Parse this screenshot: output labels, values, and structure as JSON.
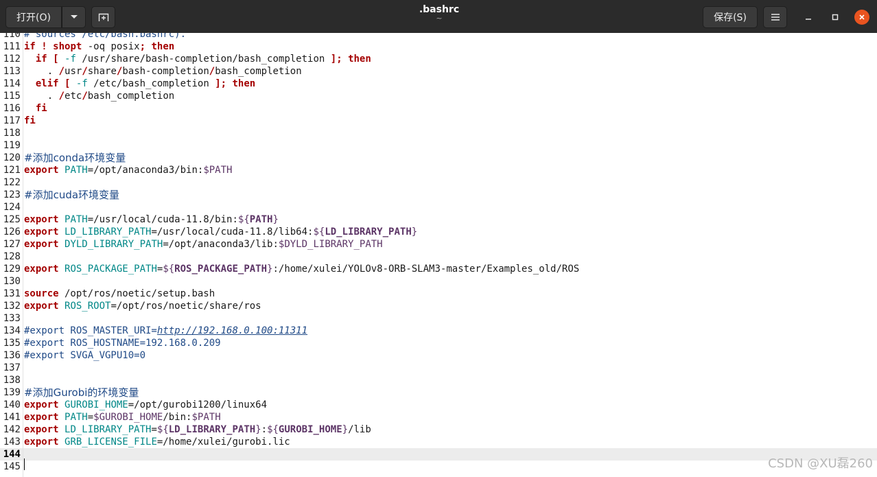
{
  "header": {
    "open_label": "打开(O)",
    "save_label": "保存(S)",
    "title": ".bashrc",
    "subtitle": "~"
  },
  "icons": {
    "open_dropdown": "chevron-down-icon",
    "new_tab": "new-tab-icon",
    "menu": "hamburger-icon",
    "minimize": "minimize-icon",
    "maximize": "maximize-icon",
    "close": "close-icon"
  },
  "colors": {
    "header_bg": "#2b2b2b",
    "close_accent": "#e95420",
    "keyword": "#a40000",
    "variable": "#008787",
    "comment": "#204a87"
  },
  "editor": {
    "current_line": "144",
    "lines": [
      {
        "n": "110",
        "parts": [
          {
            "t": "# sources /etc/bash.bashrc).",
            "c": "c"
          }
        ]
      },
      {
        "n": "111",
        "parts": [
          {
            "t": "if",
            "c": "k"
          },
          {
            "t": " ",
            "c": "t"
          },
          {
            "t": "!",
            "c": "k"
          },
          {
            "t": " ",
            "c": "t"
          },
          {
            "t": "shopt",
            "c": "k"
          },
          {
            "t": " -oq posix",
            "c": "t"
          },
          {
            "t": ";",
            "c": "k"
          },
          {
            "t": " ",
            "c": "t"
          },
          {
            "t": "then",
            "c": "k"
          }
        ]
      },
      {
        "n": "112",
        "parts": [
          {
            "t": "  ",
            "c": "t"
          },
          {
            "t": "if",
            "c": "k"
          },
          {
            "t": " ",
            "c": "t"
          },
          {
            "t": "[",
            "c": "k"
          },
          {
            "t": " ",
            "c": "t"
          },
          {
            "t": "-f",
            "c": "v"
          },
          {
            "t": " /usr/share/bash-completion/bash_completion ",
            "c": "t"
          },
          {
            "t": "];",
            "c": "k"
          },
          {
            "t": " ",
            "c": "t"
          },
          {
            "t": "then",
            "c": "k"
          }
        ]
      },
      {
        "n": "113",
        "parts": [
          {
            "t": "    . ",
            "c": "t"
          },
          {
            "t": "/",
            "c": "k"
          },
          {
            "t": "usr",
            "c": "t"
          },
          {
            "t": "/",
            "c": "k"
          },
          {
            "t": "share",
            "c": "t"
          },
          {
            "t": "/",
            "c": "k"
          },
          {
            "t": "bash-completion",
            "c": "t"
          },
          {
            "t": "/",
            "c": "k"
          },
          {
            "t": "bash_completion",
            "c": "t"
          }
        ]
      },
      {
        "n": "114",
        "parts": [
          {
            "t": "  ",
            "c": "t"
          },
          {
            "t": "elif",
            "c": "k"
          },
          {
            "t": " ",
            "c": "t"
          },
          {
            "t": "[",
            "c": "k"
          },
          {
            "t": " ",
            "c": "t"
          },
          {
            "t": "-f",
            "c": "v"
          },
          {
            "t": " /etc/bash_completion ",
            "c": "t"
          },
          {
            "t": "];",
            "c": "k"
          },
          {
            "t": " ",
            "c": "t"
          },
          {
            "t": "then",
            "c": "k"
          }
        ]
      },
      {
        "n": "115",
        "parts": [
          {
            "t": "    . ",
            "c": "t"
          },
          {
            "t": "/",
            "c": "k"
          },
          {
            "t": "etc",
            "c": "t"
          },
          {
            "t": "/",
            "c": "k"
          },
          {
            "t": "bash_completion",
            "c": "t"
          }
        ]
      },
      {
        "n": "116",
        "parts": [
          {
            "t": "  ",
            "c": "t"
          },
          {
            "t": "fi",
            "c": "k"
          }
        ]
      },
      {
        "n": "117",
        "parts": [
          {
            "t": "fi",
            "c": "k"
          }
        ]
      },
      {
        "n": "118",
        "parts": []
      },
      {
        "n": "119",
        "parts": []
      },
      {
        "n": "120",
        "parts": [
          {
            "t": "#添加conda环境变量",
            "c": "c cjk"
          }
        ]
      },
      {
        "n": "121",
        "parts": [
          {
            "t": "export",
            "c": "k"
          },
          {
            "t": " ",
            "c": "t"
          },
          {
            "t": "PATH",
            "c": "v"
          },
          {
            "t": "=/opt/anaconda3/bin:",
            "c": "t"
          },
          {
            "t": "$PATH",
            "c": "d"
          }
        ]
      },
      {
        "n": "122",
        "parts": []
      },
      {
        "n": "123",
        "parts": [
          {
            "t": "#添加cuda环境变量",
            "c": "c cjk"
          }
        ]
      },
      {
        "n": "124",
        "parts": []
      },
      {
        "n": "125",
        "parts": [
          {
            "t": "export",
            "c": "k"
          },
          {
            "t": " ",
            "c": "t"
          },
          {
            "t": "PATH",
            "c": "v"
          },
          {
            "t": "=/usr/local/cuda-11.8/bin:",
            "c": "t"
          },
          {
            "t": "${",
            "c": "d"
          },
          {
            "t": "PATH",
            "c": "db"
          },
          {
            "t": "}",
            "c": "d"
          }
        ]
      },
      {
        "n": "126",
        "parts": [
          {
            "t": "export",
            "c": "k"
          },
          {
            "t": " ",
            "c": "t"
          },
          {
            "t": "LD_LIBRARY_PATH",
            "c": "v"
          },
          {
            "t": "=/usr/local/cuda-11.8/lib64:",
            "c": "t"
          },
          {
            "t": "${",
            "c": "d"
          },
          {
            "t": "LD_LIBRARY_PATH",
            "c": "db"
          },
          {
            "t": "}",
            "c": "d"
          }
        ]
      },
      {
        "n": "127",
        "parts": [
          {
            "t": "export",
            "c": "k"
          },
          {
            "t": " ",
            "c": "t"
          },
          {
            "t": "DYLD_LIBRARY_PATH",
            "c": "v"
          },
          {
            "t": "=/opt/anaconda3/lib:",
            "c": "t"
          },
          {
            "t": "$DYLD_LIBRARY_PATH",
            "c": "d"
          }
        ]
      },
      {
        "n": "128",
        "parts": []
      },
      {
        "n": "129",
        "parts": [
          {
            "t": "export",
            "c": "k"
          },
          {
            "t": " ",
            "c": "t"
          },
          {
            "t": "ROS_PACKAGE_PATH",
            "c": "v"
          },
          {
            "t": "=",
            "c": "t"
          },
          {
            "t": "${",
            "c": "d"
          },
          {
            "t": "ROS_PACKAGE_PATH",
            "c": "db"
          },
          {
            "t": "}",
            "c": "d"
          },
          {
            "t": ":/home/xulei/YOLOv8-ORB-SLAM3-master/Examples_old/ROS",
            "c": "t"
          }
        ]
      },
      {
        "n": "130",
        "parts": []
      },
      {
        "n": "131",
        "parts": [
          {
            "t": "source",
            "c": "k"
          },
          {
            "t": " /opt/ros/noetic/setup.bash",
            "c": "t"
          }
        ]
      },
      {
        "n": "132",
        "parts": [
          {
            "t": "export",
            "c": "k"
          },
          {
            "t": " ",
            "c": "t"
          },
          {
            "t": "ROS_ROOT",
            "c": "v"
          },
          {
            "t": "=/opt/ros/noetic/share/ros",
            "c": "t"
          }
        ]
      },
      {
        "n": "133",
        "parts": []
      },
      {
        "n": "134",
        "parts": [
          {
            "t": "#export ROS_MASTER_URI=",
            "c": "c"
          },
          {
            "t": "http://192.168.0.100:11311",
            "c": "u"
          }
        ]
      },
      {
        "n": "135",
        "parts": [
          {
            "t": "#export ROS_HOSTNAME=192.168.0.209",
            "c": "c"
          }
        ]
      },
      {
        "n": "136",
        "parts": [
          {
            "t": "#export SVGA_VGPU10=0",
            "c": "c"
          }
        ]
      },
      {
        "n": "137",
        "parts": []
      },
      {
        "n": "138",
        "parts": []
      },
      {
        "n": "139",
        "parts": [
          {
            "t": "#添加Gurobi的环境变量",
            "c": "c cjk"
          }
        ]
      },
      {
        "n": "140",
        "parts": [
          {
            "t": "export",
            "c": "k"
          },
          {
            "t": " ",
            "c": "t"
          },
          {
            "t": "GUROBI_HOME",
            "c": "v"
          },
          {
            "t": "=/opt/gurobi1200/linux64",
            "c": "t"
          }
        ]
      },
      {
        "n": "141",
        "parts": [
          {
            "t": "export",
            "c": "k"
          },
          {
            "t": " ",
            "c": "t"
          },
          {
            "t": "PATH",
            "c": "v"
          },
          {
            "t": "=",
            "c": "t"
          },
          {
            "t": "$GUROBI_HOME",
            "c": "d"
          },
          {
            "t": "/bin:",
            "c": "t"
          },
          {
            "t": "$PATH",
            "c": "d"
          }
        ]
      },
      {
        "n": "142",
        "parts": [
          {
            "t": "export",
            "c": "k"
          },
          {
            "t": " ",
            "c": "t"
          },
          {
            "t": "LD_LIBRARY_PATH",
            "c": "v"
          },
          {
            "t": "=",
            "c": "t"
          },
          {
            "t": "${",
            "c": "d"
          },
          {
            "t": "LD_LIBRARY_PATH",
            "c": "db"
          },
          {
            "t": "}",
            "c": "d"
          },
          {
            "t": ":",
            "c": "t"
          },
          {
            "t": "${",
            "c": "d"
          },
          {
            "t": "GUROBI_HOME",
            "c": "db"
          },
          {
            "t": "}",
            "c": "d"
          },
          {
            "t": "/lib",
            "c": "t"
          }
        ]
      },
      {
        "n": "143",
        "parts": [
          {
            "t": "export",
            "c": "k"
          },
          {
            "t": " ",
            "c": "t"
          },
          {
            "t": "GRB_LICENSE_FILE",
            "c": "v"
          },
          {
            "t": "=/home/xulei/gurobi.lic",
            "c": "t"
          }
        ]
      },
      {
        "n": "144",
        "parts": []
      },
      {
        "n": "145",
        "parts": []
      }
    ]
  },
  "watermark": "CSDN @XU磊260"
}
